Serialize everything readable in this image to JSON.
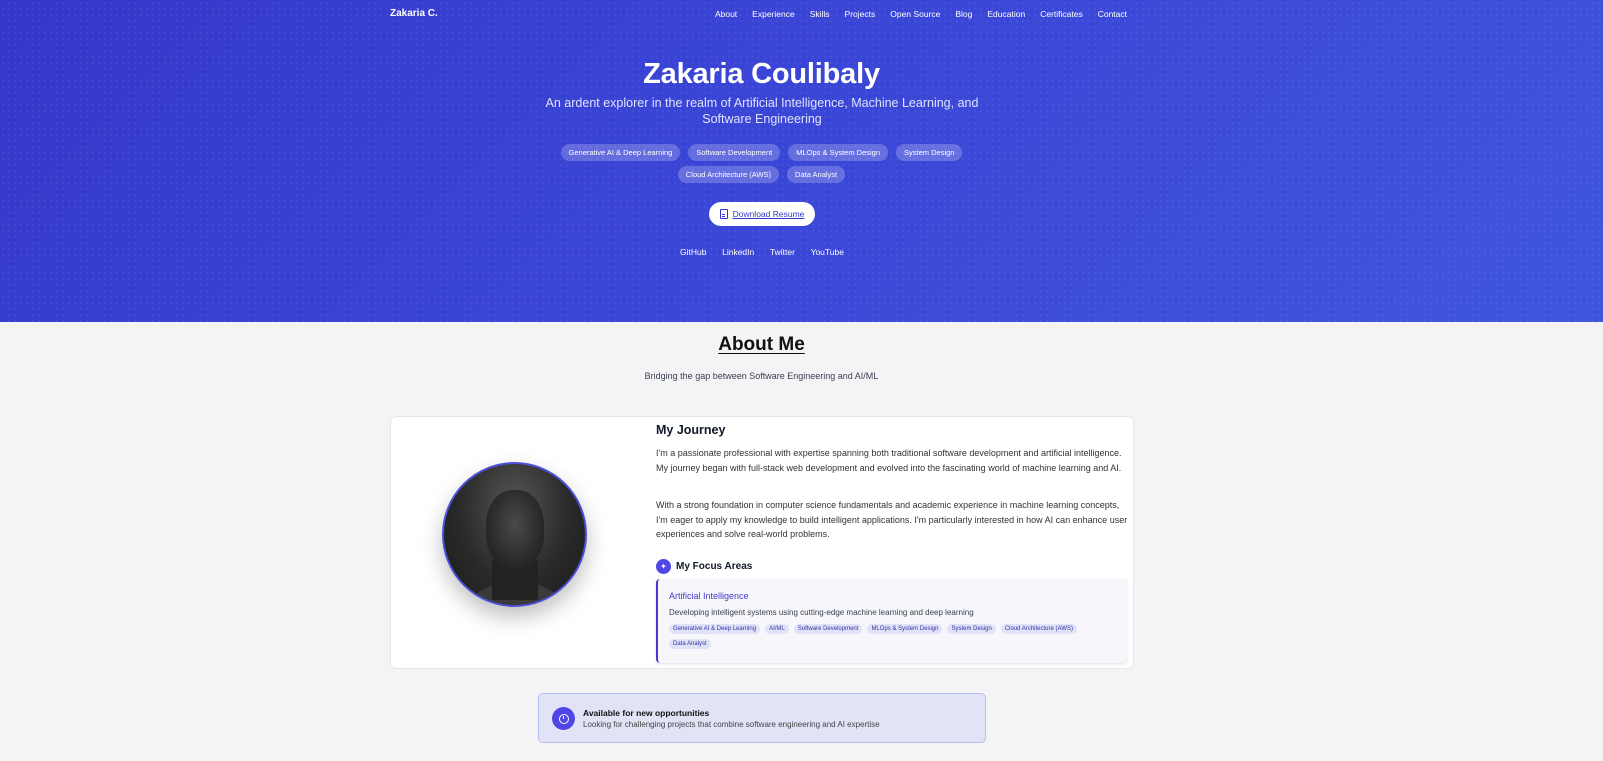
{
  "nav": {
    "brand": "Zakaria C.",
    "links": [
      "About",
      "Experience",
      "Skills",
      "Projects",
      "Open Source",
      "Blog",
      "Education",
      "Certificates",
      "Contact"
    ]
  },
  "hero": {
    "name": "Zakaria Coulibaly",
    "tagline": "An ardent explorer in the realm of Artificial Intelligence, Machine Learning, and Software Engineering",
    "tags_row1": [
      "Generative AI & Deep Learning",
      "Software Development",
      "MLOps & System Design",
      "System Design"
    ],
    "tags_row2": [
      "Cloud Architecture (AWS)",
      "Data Analyst"
    ],
    "resume_label": "Download Resume",
    "socials": [
      "GitHub",
      "LinkedIn",
      "Twitter",
      "YouTube"
    ]
  },
  "about": {
    "title": "About Me",
    "subtitle": "Bridging the gap between Software Engineering and AI/ML",
    "journey_title": "My Journey",
    "paragraph1": "I'm a passionate professional with expertise spanning both traditional software development and artificial intelligence. My journey began with full-stack web development and evolved into the fascinating world of machine learning and AI.",
    "paragraph2": "With a strong foundation in computer science fundamentals and academic experience in machine learning concepts, I'm eager to apply my knowledge to build intelligent applications. I'm particularly interested in how AI can enhance user experiences and solve real-world problems.",
    "focus_title": "My Focus Areas",
    "focus": {
      "title": "Artificial Intelligence",
      "description": "Developing intelligent systems using cutting-edge machine learning and deep learning",
      "tags": [
        "Generative AI & Deep Learning",
        "AI/ML",
        "Software Development",
        "MLOps & System Design",
        "System Design",
        "Cloud Architecture (AWS)",
        "Data Analyst"
      ]
    }
  },
  "availability": {
    "title": "Available for new opportunities",
    "description": "Looking for challenging projects that combine software engineering and AI expertise"
  },
  "colors": {
    "hero_start": "#3437c9",
    "hero_end": "#3f55dc",
    "accent": "#4f46e5"
  }
}
